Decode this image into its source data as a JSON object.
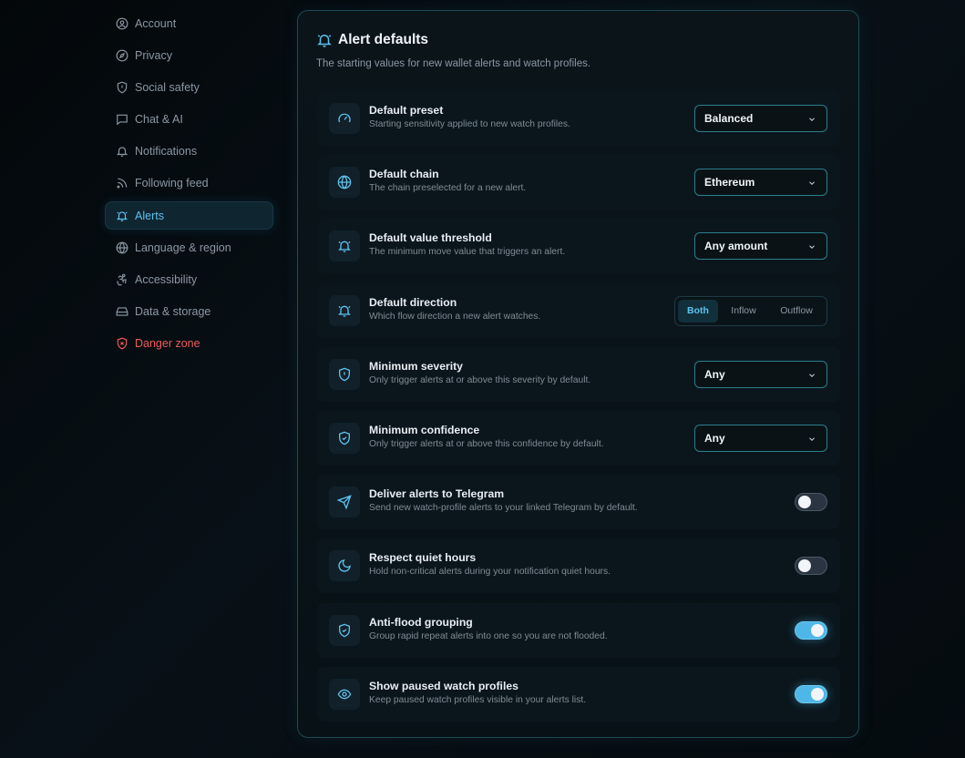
{
  "sidebar": {
    "items": [
      {
        "label": "Account",
        "icon": "user-circle-icon"
      },
      {
        "label": "Privacy",
        "icon": "compass-icon"
      },
      {
        "label": "Social safety",
        "icon": "shield-icon"
      },
      {
        "label": "Chat & AI",
        "icon": "chat-icon"
      },
      {
        "label": "Notifications",
        "icon": "bell-icon"
      },
      {
        "label": "Following feed",
        "icon": "rss-icon"
      },
      {
        "label": "Alerts",
        "icon": "bell-ring-icon",
        "active": true
      },
      {
        "label": "Language & region",
        "icon": "globe-icon"
      },
      {
        "label": "Accessibility",
        "icon": "accessibility-icon"
      },
      {
        "label": "Data & storage",
        "icon": "storage-icon"
      },
      {
        "label": "Danger zone",
        "icon": "shield-x-icon",
        "danger": true
      }
    ]
  },
  "card": {
    "title": "Alert defaults",
    "subtitle": "The starting values for new wallet alerts and watch profiles."
  },
  "rows": {
    "preset": {
      "label": "Default preset",
      "desc": "Starting sensitivity applied to new watch profiles.",
      "value": "Balanced"
    },
    "chain": {
      "label": "Default chain",
      "desc": "The chain preselected for a new alert.",
      "value": "Ethereum"
    },
    "threshold": {
      "label": "Default value threshold",
      "desc": "The minimum move value that triggers an alert.",
      "value": "Any amount"
    },
    "direction": {
      "label": "Default direction",
      "desc": "Which flow direction a new alert watches.",
      "options": [
        "Both",
        "Inflow",
        "Outflow"
      ],
      "selected": "Both"
    },
    "severity": {
      "label": "Minimum severity",
      "desc": "Only trigger alerts at or above this severity by default.",
      "value": "Any"
    },
    "confidence": {
      "label": "Minimum confidence",
      "desc": "Only trigger alerts at or above this confidence by default.",
      "value": "Any"
    },
    "telegram": {
      "label": "Deliver alerts to Telegram",
      "desc": "Send new watch-profile alerts to your linked Telegram by default.",
      "on": false
    },
    "quiet": {
      "label": "Respect quiet hours",
      "desc": "Hold non-critical alerts during your notification quiet hours.",
      "on": false
    },
    "antiflood": {
      "label": "Anti-flood grouping",
      "desc": "Group rapid repeat alerts into one so you are not flooded.",
      "on": true
    },
    "paused": {
      "label": "Show paused watch profiles",
      "desc": "Keep paused watch profiles visible in your alerts list.",
      "on": true
    }
  },
  "colors": {
    "accent": "#5ec2ef",
    "danger": "#ef5a5a",
    "toggle_on": "#4fb7e8"
  }
}
